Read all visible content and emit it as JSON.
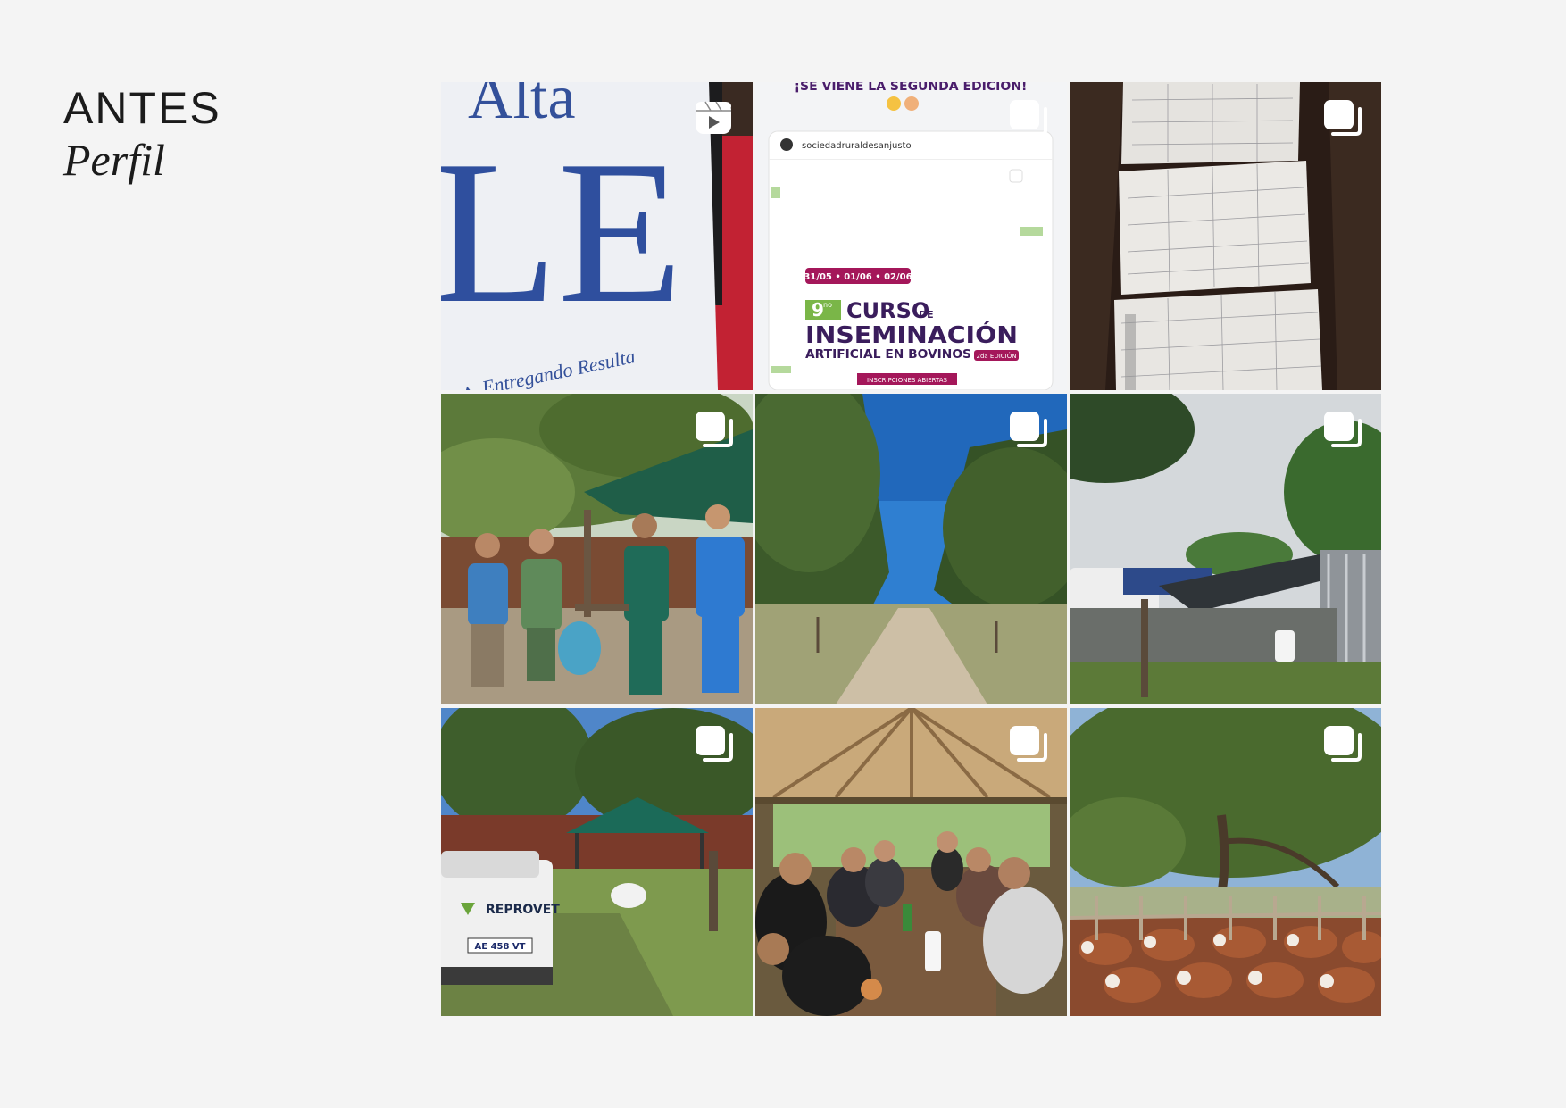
{
  "heading": {
    "title": "ANTES",
    "subtitle": "Perfil"
  },
  "posts": [
    {
      "type": "reel",
      "badge_icon": "reel-icon",
      "scene": "banner",
      "banner_text": "LE",
      "banner_top_text": "Alta",
      "banner_caption": "a ▲ Entregando Resulta"
    },
    {
      "type": "carousel",
      "badge_icon": "carousel-icon",
      "scene": "flyer",
      "flyer_top": "¡SE VIENE LA SEGUNDA EDICIÓN!",
      "flyer_account": "sociedadruraldesanjusto",
      "flyer_dates": "31/05 • 01/06 • 02/06",
      "flyer_number": "9",
      "flyer_number_sup": "no",
      "flyer_word1": "CURSO",
      "flyer_de": "DE",
      "flyer_word2": "INSEMINACIÓN",
      "flyer_word3": "ARTIFICIAL EN BOVINOS",
      "flyer_edition": "2da EDICIÓN",
      "flyer_cta": "INSCRIPCIONES ABIERTAS"
    },
    {
      "type": "carousel",
      "badge_icon": "carousel-icon",
      "scene": "papers"
    },
    {
      "type": "carousel",
      "badge_icon": "carousel-icon",
      "scene": "team"
    },
    {
      "type": "carousel",
      "badge_icon": "carousel-icon",
      "scene": "road"
    },
    {
      "type": "carousel",
      "badge_icon": "carousel-icon",
      "scene": "shed"
    },
    {
      "type": "carousel",
      "badge_icon": "carousel-icon",
      "scene": "truck",
      "truck_brand": "REPROVET",
      "truck_plate": "AE 458 VT"
    },
    {
      "type": "carousel",
      "badge_icon": "carousel-icon",
      "scene": "lunch"
    },
    {
      "type": "carousel",
      "badge_icon": "carousel-icon",
      "scene": "cattle"
    }
  ]
}
